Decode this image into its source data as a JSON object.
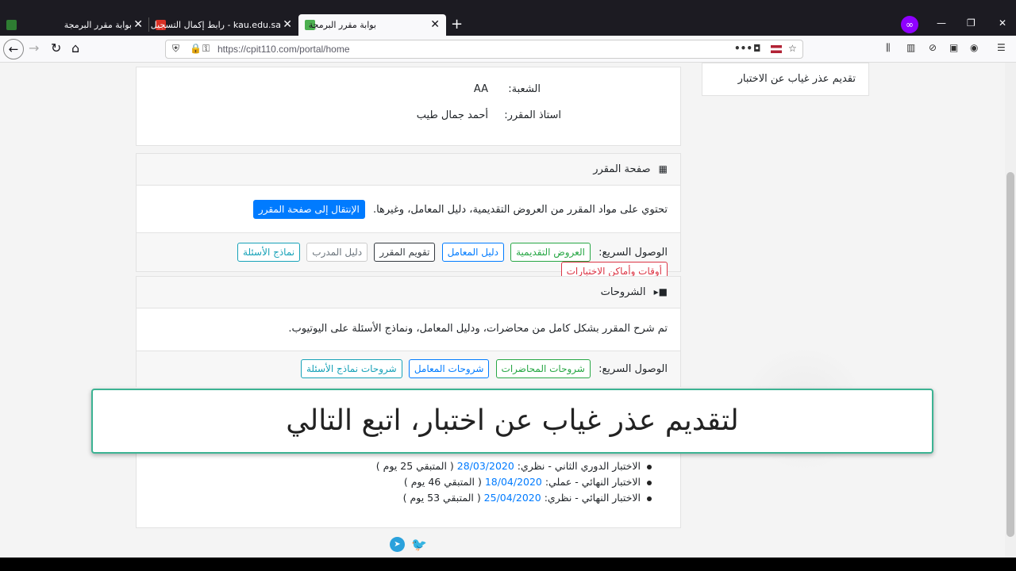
{
  "browser": {
    "tabs": [
      {
        "label": "بوابة مقرر البرمجة"
      },
      {
        "label": "kau.edu.sa - رابط إكمال التسجيل"
      },
      {
        "label": "بوابة مقرر البرمجة"
      }
    ],
    "url": "https://cpit110.com/portal/home",
    "new_tab": "+"
  },
  "side": {
    "absence_link": "تقديم عذر غياب عن الاختبار"
  },
  "info": {
    "section_label": "الشعبة:",
    "section_value": "AA",
    "instructor_label": "استاذ المقرر:",
    "instructor_value": "أحمد جمال طيب"
  },
  "course_page": {
    "title": "صفحة المقرر",
    "description": "تحتوي على مواد المقرر من العروض التقديمية، دليل المعامل، وغيرها.",
    "go_button": "الإنتقال إلى صفحة المقرر",
    "quick_label": "الوصول السريع:",
    "quick_links": [
      "العروض التقديمية",
      "دليل المعامل",
      "تقويم المقرر",
      "دليل المدرب",
      "نماذج الأسئلة",
      "أوقات وأماكن الاختبارات"
    ]
  },
  "explanations": {
    "title": "الشروحات",
    "description": "تم شرح المقرر بشكل كامل من محاضرات، ودليل المعامل، ونماذج الأسئلة على اليوتيوب.",
    "quick_label": "الوصول السريع:",
    "quick_links": [
      "شروحات المحاضرات",
      "شروحات المعامل",
      "شروحات نماذج الأسئلة"
    ]
  },
  "overlay": {
    "caption": "لتقديم عذر غياب عن اختبار، اتبع التالي"
  },
  "exams": [
    {
      "name": "الاختبار الدوري الثاني - نظري: ",
      "date": "28/03/2020",
      "remaining": " ( المتبقي 25 يوم )"
    },
    {
      "name": "الاختبار النهائي - عملي: ",
      "date": "18/04/2020",
      "remaining": " ( المتبقي 46 يوم )"
    },
    {
      "name": "الاختبار النهائي - نظري: ",
      "date": "25/04/2020",
      "remaining": " ( المتبقي 53 يوم )"
    }
  ],
  "colors": {
    "accent": "#007bff",
    "overlay_border": "#3cb393"
  }
}
